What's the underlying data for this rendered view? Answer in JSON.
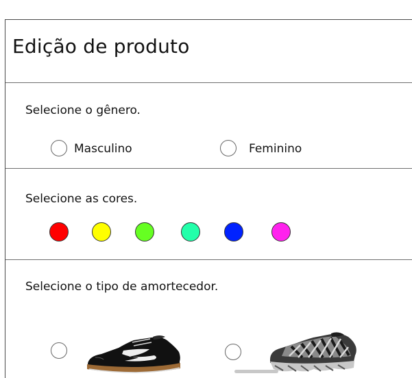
{
  "header": {
    "title": "Edição de produto"
  },
  "gender": {
    "prompt": "Selecione o gênero.",
    "options": [
      {
        "label": "Masculino",
        "selected": false
      },
      {
        "label": "Feminino",
        "selected": false
      }
    ]
  },
  "colors": {
    "prompt": "Selecione as cores.",
    "swatches": [
      {
        "name": "red",
        "hex": "#ff0000"
      },
      {
        "name": "yellow",
        "hex": "#ffff00"
      },
      {
        "name": "green",
        "hex": "#66ff22"
      },
      {
        "name": "teal",
        "hex": "#22ffaa"
      },
      {
        "name": "blue",
        "hex": "#0022ff"
      },
      {
        "name": "magenta",
        "hex": "#ff22ee"
      }
    ]
  },
  "cushion": {
    "prompt": "Selecione o tipo de amortecedor.",
    "options": [
      {
        "image": "black-indoor-sneaker",
        "selected": false
      },
      {
        "image": "knit-running-sneaker",
        "selected": false
      }
    ]
  }
}
